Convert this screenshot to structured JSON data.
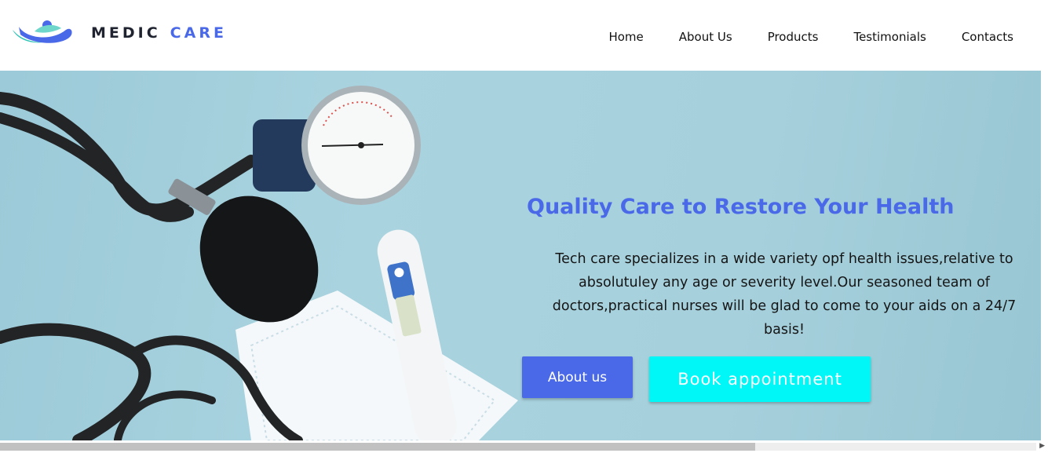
{
  "brand": {
    "name_part1": "MEDIC",
    "name_part2": "CARE",
    "logo_icon": "heart-hands-icon",
    "colors": {
      "dark": "#1f2430",
      "accent": "#4a69e8",
      "teal": "#2ec4b6"
    }
  },
  "nav": {
    "items": [
      {
        "label": "Home"
      },
      {
        "label": "About Us"
      },
      {
        "label": "Products"
      },
      {
        "label": "Testimonials"
      },
      {
        "label": "Contacts"
      }
    ]
  },
  "hero": {
    "title": "Quality Care to Restore Your Health",
    "description": "Tech care specializes in a wide variety opf health issues,relative to absolutuley any age or severity level.Our seasoned team of doctors,practical nurses will be glad to come to your aids on a 24/7 basis!",
    "image_icon": "stethoscope-blood-pressure-thermometer-image",
    "buttons": {
      "about_label": "About us",
      "book_label": "Book appointment"
    },
    "colors": {
      "title": "#4a69e8",
      "about_bg": "#4a69e8",
      "book_bg": "#00f7f7",
      "background": "#a6d0dc"
    }
  },
  "scrollbar": {
    "arrow_icon": "right-arrow-icon",
    "arrow_glyph": "▶"
  }
}
